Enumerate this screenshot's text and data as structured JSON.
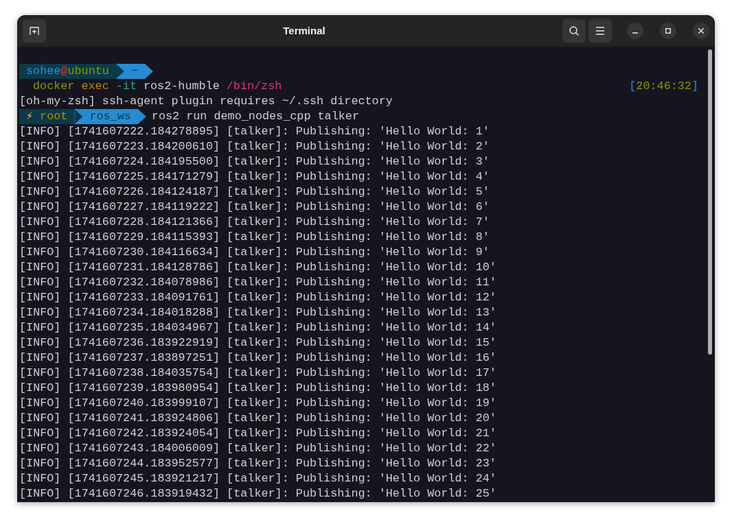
{
  "window": {
    "title": "Terminal"
  },
  "lines": [
    {
      "segments": [
        {
          "color": "#0b3a48",
          "parts": [
            {
              "text": "sohee",
              "kind": "user"
            },
            {
              "text": "@",
              "kind": "at"
            },
            {
              "text": "ubuntu",
              "kind": "host"
            }
          ]
        },
        {
          "color": "#268bd2",
          "parts": [
            {
              "text": "~",
              "kind": "dir"
            }
          ]
        }
      ]
    },
    {
      "command": [
        {
          "text": "docker",
          "kind": "program"
        },
        {
          "text": "exec",
          "kind": "subcommand"
        },
        {
          "text": "-it",
          "kind": "option"
        },
        {
          "text": "ros2-humble",
          "kind": "argument"
        },
        {
          "text": "/bin/zsh",
          "kind": "path"
        }
      ],
      "clock": [
        {
          "text": "[",
          "kind": "bracket"
        },
        {
          "text": "20:46:32",
          "kind": "time"
        },
        {
          "text": "]",
          "kind": "bracket"
        }
      ]
    },
    {
      "output": "[oh-my-zsh] ssh-agent plugin requires ~/.ssh directory"
    },
    {
      "segments": [
        {
          "color": "#0b3a48",
          "parts": [
            {
              "text": "⚡",
              "kind": "icon"
            },
            {
              "text": "root",
              "kind": "user_root"
            }
          ]
        },
        {
          "color": "#268bd2",
          "parts": [
            {
              "text": "ros_ws",
              "kind": "dir"
            }
          ]
        }
      ],
      "command": [
        {
          "text": "ros2 run demo_nodes_cpp talker",
          "kind": "argument"
        }
      ]
    }
  ],
  "log_lines": [
    "[INFO] [1741607222.184278895] [talker]: Publishing: 'Hello World: 1'",
    "[INFO] [1741607223.184200610] [talker]: Publishing: 'Hello World: 2'",
    "[INFO] [1741607224.184195500] [talker]: Publishing: 'Hello World: 3'",
    "[INFO] [1741607225.184171279] [talker]: Publishing: 'Hello World: 4'",
    "[INFO] [1741607226.184124187] [talker]: Publishing: 'Hello World: 5'",
    "[INFO] [1741607227.184119222] [talker]: Publishing: 'Hello World: 6'",
    "[INFO] [1741607228.184121366] [talker]: Publishing: 'Hello World: 7'",
    "[INFO] [1741607229.184115393] [talker]: Publishing: 'Hello World: 8'",
    "[INFO] [1741607230.184116634] [talker]: Publishing: 'Hello World: 9'",
    "[INFO] [1741607231.184128786] [talker]: Publishing: 'Hello World: 10'",
    "[INFO] [1741607232.184078986] [talker]: Publishing: 'Hello World: 11'",
    "[INFO] [1741607233.184091761] [talker]: Publishing: 'Hello World: 12'",
    "[INFO] [1741607234.184018288] [talker]: Publishing: 'Hello World: 13'",
    "[INFO] [1741607235.184034967] [talker]: Publishing: 'Hello World: 14'",
    "[INFO] [1741607236.183922919] [talker]: Publishing: 'Hello World: 15'",
    "[INFO] [1741607237.183897251] [talker]: Publishing: 'Hello World: 16'",
    "[INFO] [1741607238.184035754] [talker]: Publishing: 'Hello World: 17'",
    "[INFO] [1741607239.183980954] [talker]: Publishing: 'Hello World: 18'",
    "[INFO] [1741607240.183999107] [talker]: Publishing: 'Hello World: 19'",
    "[INFO] [1741607241.183924806] [talker]: Publishing: 'Hello World: 20'",
    "[INFO] [1741607242.183924054] [talker]: Publishing: 'Hello World: 21'",
    "[INFO] [1741607243.184006009] [talker]: Publishing: 'Hello World: 22'",
    "[INFO] [1741607244.183952577] [talker]: Publishing: 'Hello World: 23'",
    "[INFO] [1741607245.183921217] [talker]: Publishing: 'Hello World: 24'",
    "[INFO] [1741607246.183919432] [talker]: Publishing: 'Hello World: 25'"
  ]
}
